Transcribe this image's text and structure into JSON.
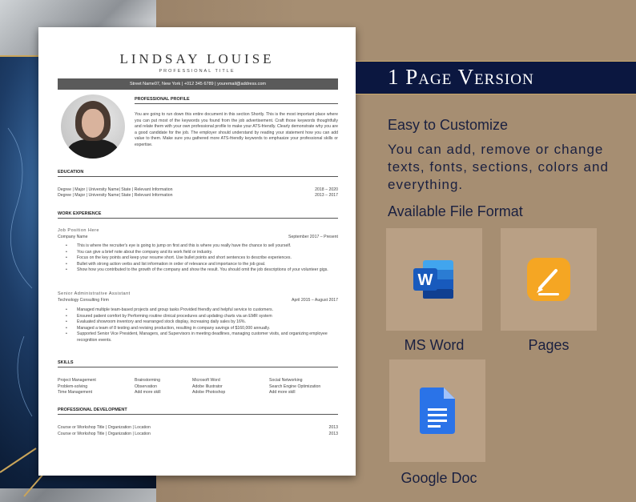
{
  "resume": {
    "name": "LINDSAY LOUISE",
    "title": "PROFESSIONAL TITLE",
    "contact": "Street Name07, New York | +012 345 6789 | youremail@address.com",
    "profile": {
      "heading": "PROFESSIONAL PROFILE",
      "text": "You are going to run down this entire document in this section Shortly. This is the most important place where you can put most of the keywords you found from the job advertisement. Craft those keywords thoughtfully and relate them with your own professional profile to make your ATS-friendly. Clearly demonstrate why you are a good candidate for the job. The employer should understand by reading your statement how you can add value to them. Make sure you gathered more ATS-friendly keywords to emphasize your professional skills or expertise."
    },
    "education": {
      "heading": "EDUCATION",
      "rows": [
        {
          "text": "Degree | Major | University Name| State | Relevant Information",
          "date": "2018 – 2020"
        },
        {
          "text": "Degree | Major | University Name| State | Relevant Information",
          "date": "2013 – 2017"
        }
      ]
    },
    "experience": {
      "heading": "WORK EXPERIENCE",
      "jobs": [
        {
          "title": "Job Position Here",
          "company": "Company Name",
          "date": "September 2017 – Present",
          "bullets": [
            "This is where the recruiter's eye is going to jump on first and this is where you really have the chance to sell yourself.",
            "You can give a brief note about the company and its work field or industry.",
            "Focus on the key points and keep your resume short. Use bullet points and short sentences to describe experiences.",
            "Bullet with strong action verbs and list information in order of relevance and importance to the job goal.",
            "Show how you contributed to the growth of the company and show the result. You should omit the job descriptions of your volunteer gigs."
          ]
        },
        {
          "title": "Senior Administrative Assistant",
          "company": "Technology Consulting Firm",
          "date": "April 2015 – August 2017",
          "bullets": [
            "Managed multiple team-based projects and group tasks Provided friendly and helpful service to customers.",
            "Ensured patient comfort by Performing routine clinical procedures and updating charts via an EMR system",
            "Evaluated showroom inventory and rearranged stock display, increasing daily sales by 16%.",
            "Managed a team of 8 testing and revising production, resulting in company savings of $160,000 annually.",
            "Supported Senior Vice President, Managers, and Supervisors in meeting deadlines, managing customer visits, and organizing employee recognition events."
          ]
        }
      ]
    },
    "skills": {
      "heading": "SKILLS",
      "items": [
        "Project Management",
        "Brainstorming",
        "Microsoft Word",
        "Social Networking",
        "Problem-solving",
        "Observation",
        "Adobe Illustrator",
        "Search Engine Optimization",
        "Time Management",
        "Add more skill",
        "Adobe Photoshop",
        "Add more skill"
      ]
    },
    "development": {
      "heading": "PROFESSIONAL DEVELOPMENT",
      "rows": [
        {
          "text": "Course or Workshop Title | Organization | Location",
          "date": "2013"
        },
        {
          "text": "Course or Workshop Title | Organization | Location",
          "date": "2013"
        }
      ]
    }
  },
  "promo": {
    "banner": "1 Page Version",
    "heading": "Easy to Customize",
    "description": "You can add, remove or change texts, fonts, sections, colors and everything.",
    "formats_heading": "Available  File Format",
    "formats": [
      {
        "label": "MS Word",
        "icon": "ms-word-icon",
        "color": "#185abd"
      },
      {
        "label": "Pages",
        "icon": "pages-icon",
        "color": "#f5a623"
      },
      {
        "label": "Google Doc",
        "icon": "google-docs-icon",
        "color": "#2a73e8"
      }
    ]
  }
}
